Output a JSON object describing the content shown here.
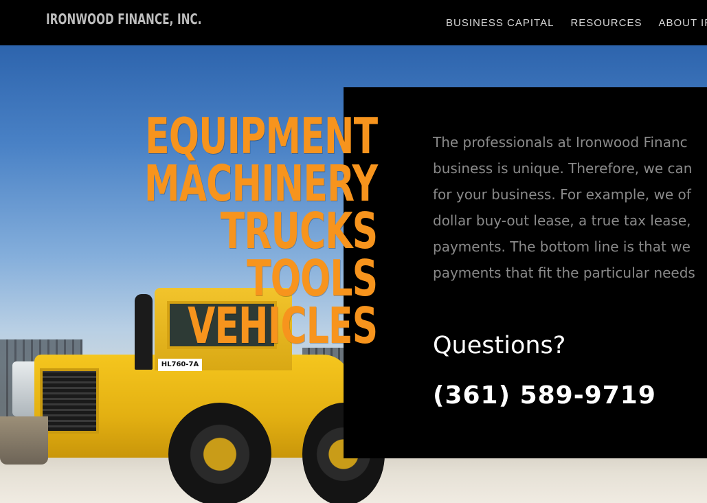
{
  "header": {
    "brand": "IRONWOOD FINANCE, INC.",
    "nav": [
      {
        "label": "BUSINESS CAPITAL"
      },
      {
        "label": "RESOURCES"
      },
      {
        "label": "ABOUT IR"
      }
    ]
  },
  "hero": {
    "words": [
      "EQUIPMENT",
      "MACHINERY",
      "TRUCKS",
      "TOOLS",
      "VEHICLES"
    ],
    "word_color": "#f7941d",
    "loader_plate": "HL760-7A"
  },
  "panel": {
    "intro_lines": [
      "The professionals at Ironwood Financ",
      "business is unique. Therefore, we can",
      "for your business. For example, we of",
      "dollar buy-out lease, a true tax lease,",
      "payments. The bottom line is that we",
      "payments that fit the particular needs"
    ],
    "questions": "Questions?",
    "phone": "(361) 589-9719"
  }
}
